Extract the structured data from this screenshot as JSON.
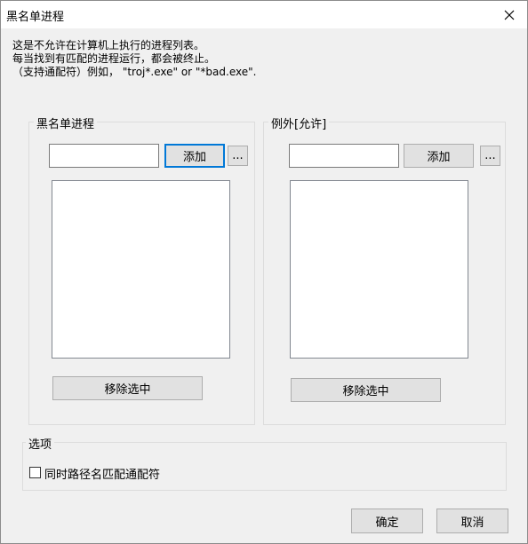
{
  "window": {
    "title": "黑名单进程",
    "close_glyph": "✕"
  },
  "description": {
    "line1": "这是不允许在计算机上执行的进程列表。",
    "line2": "每当找到有匹配的进程运行，都会被终止。",
    "line3": "（支持通配符）例如， \"troj*.exe\" or \"*bad.exe\"."
  },
  "blacklist": {
    "label": "黑名单进程",
    "input_value": "",
    "add_label": "添加",
    "browse_label": "...",
    "items": [],
    "remove_label": "移除选中"
  },
  "exceptions": {
    "label": "例外[允许]",
    "input_value": "",
    "add_label": "添加",
    "browse_label": "...",
    "items": [],
    "remove_label": "移除选中"
  },
  "options": {
    "label": "选项",
    "wildcard_checkbox_label": "同时路径名匹配通配符",
    "wildcard_checked": false
  },
  "footer": {
    "ok_label": "确定",
    "cancel_label": "取消"
  }
}
